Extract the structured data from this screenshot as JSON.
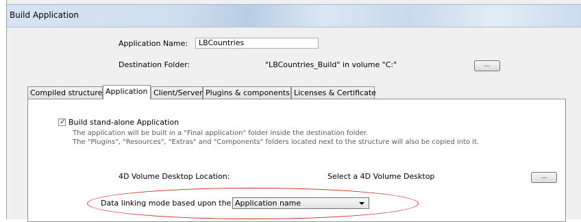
{
  "window": {
    "title": "Build Application"
  },
  "header": {
    "app_name_label": "Application Name:",
    "app_name_value": "LBCountries",
    "dest_folder_label": "Destination Folder:",
    "dest_folder_value": "\"LBCountries_Build\" in volume \"C:\"",
    "browse_label": "..."
  },
  "tabs": [
    {
      "label": "Compiled structure",
      "active": false
    },
    {
      "label": "Application",
      "active": true
    },
    {
      "label": "Client/Server",
      "active": false
    },
    {
      "label": "Plugins & components",
      "active": false
    },
    {
      "label": "Licenses & Certificate",
      "active": false
    }
  ],
  "application_tab": {
    "build_standalone": {
      "label": "Build stand-alone Application",
      "checked": true,
      "desc_line1": "The application will be built in a \"Final application\" folder inside the destination folder.",
      "desc_line2": "The \"Plugins\", \"Resources\", \"Extras\" and \"Components\" folders located next to the structure will also be copied into it."
    },
    "volume_desktop": {
      "label": "4D Volume Desktop Location:",
      "value": "Select a 4D Volume Desktop",
      "browse_label": "..."
    },
    "data_linking": {
      "label": "Data linking mode based upon the",
      "selected": "Application name"
    }
  },
  "colors": {
    "highlight_ellipse": "#d22a1f",
    "titlebar": "#cfdeee"
  }
}
